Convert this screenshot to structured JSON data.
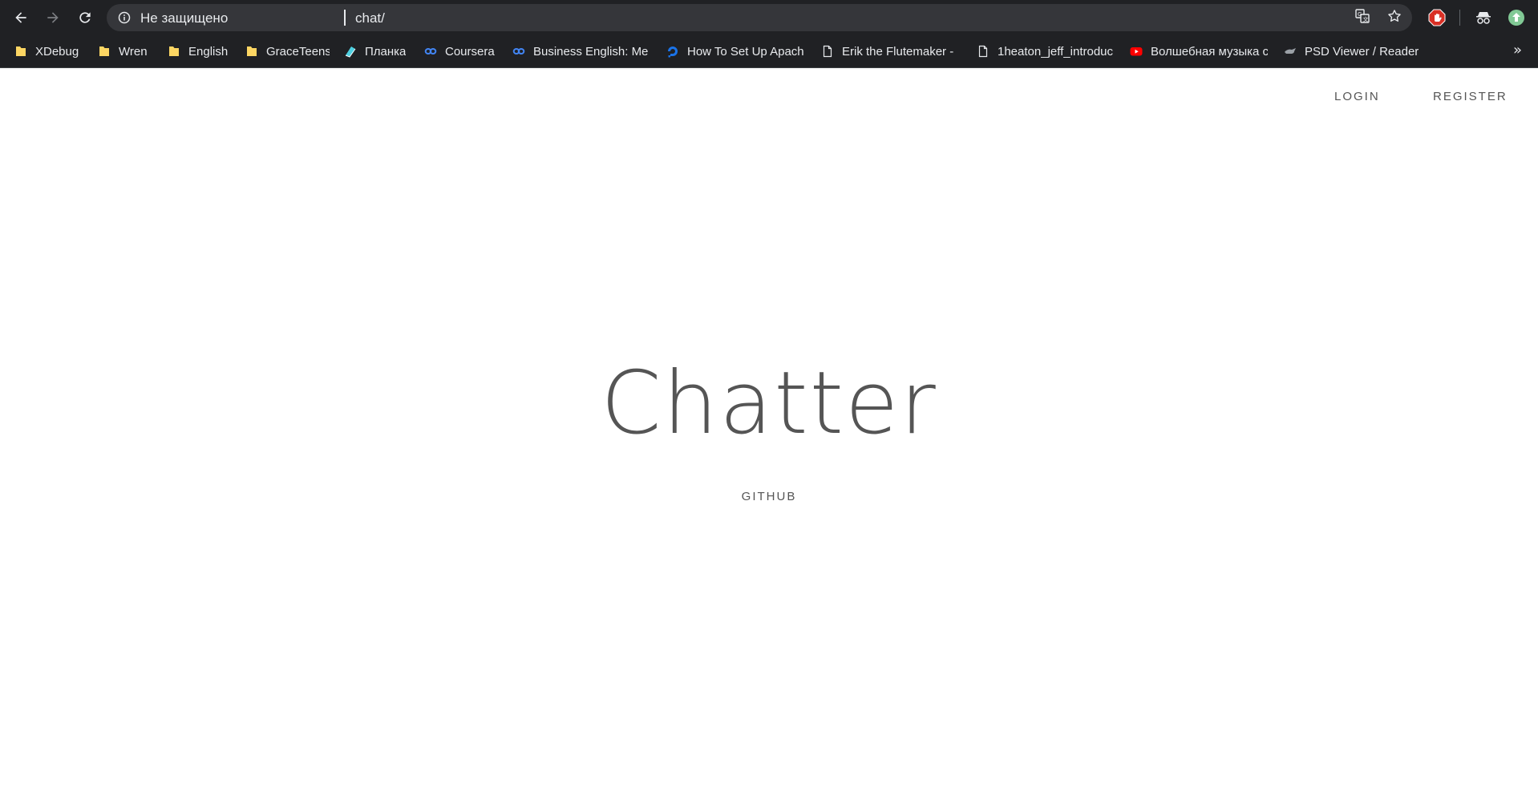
{
  "browser": {
    "security_label": "Не защищено",
    "url": "chat/",
    "bookmarks": [
      {
        "label": "XDebug",
        "icon": "folder-icon"
      },
      {
        "label": "Wren",
        "icon": "folder-icon"
      },
      {
        "label": "English",
        "icon": "folder-icon"
      },
      {
        "label": "GraceTeens",
        "icon": "folder-icon"
      },
      {
        "label": "Планка",
        "icon": "planka-icon"
      },
      {
        "label": "Coursera",
        "icon": "coursera-icon"
      },
      {
        "label": "Business English: Mee",
        "icon": "coursera-icon"
      },
      {
        "label": "How To Set Up Apach",
        "icon": "digitalocean-icon"
      },
      {
        "label": "Erik the Flutemaker -",
        "icon": "document-icon"
      },
      {
        "label": "1heaton_jeff_introduc",
        "icon": "document-icon"
      },
      {
        "label": "Волшебная музыка с",
        "icon": "youtube-icon"
      },
      {
        "label": "PSD Viewer / Reader",
        "icon": "psd-viewer-icon"
      }
    ],
    "more_bookmarks": "»"
  },
  "page": {
    "nav": {
      "login": "LOGIN",
      "register": "REGISTER"
    },
    "title": "Chatter",
    "github": "GITHUB"
  }
}
